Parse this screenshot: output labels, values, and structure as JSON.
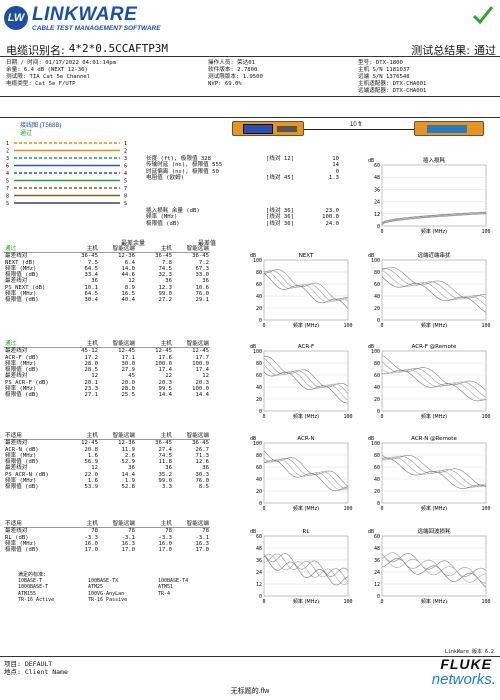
{
  "brand": {
    "logo_letters": "LW",
    "name": "LINKWARE",
    "tagline": "CABLE TEST MANAGEMENT SOFTWARE",
    "accent": "#1b4fa3",
    "pass_color": "#2aa52a"
  },
  "header": {
    "cable_id_label": "电缆识别名:",
    "cable_id": "4*2*0.5CCAFTP3M",
    "overall_label": "测试总结果:",
    "overall": "通过",
    "left_lines": [
      "日期 / 时间: 01/17/2022 04:01:14pm",
      "余量: 6.4 dB (NEXT 12-36)",
      "测试限: TIA Cat 5e Channel",
      "电缆类型: Cat 5e F/UTP"
    ],
    "mid_lines": [
      "操作人员: 荣达01",
      "软件版本: 2.7800",
      "测试限版本: 1.9500",
      "NVP: 69.0%"
    ],
    "right_lines": [
      "型号: DTX-1800",
      "主机 S/N 1181037",
      "远端 S/N 1376548",
      "主机适配器: DTX-CHA001",
      "远端适配器: DTX-CHA001"
    ]
  },
  "wiremap": {
    "title": "接线图 (T568B)",
    "result": "通过",
    "pins_left": [
      "1",
      "2",
      "3",
      "6",
      "4",
      "5",
      "7",
      "8",
      "S"
    ],
    "pins_right": [
      "1",
      "2",
      "3",
      "6",
      "4",
      "5",
      "7",
      "8",
      "S"
    ],
    "length_label": "10 ft",
    "colors": [
      "#e88a1a",
      "#e88a1a",
      "#2e9a3a",
      "#2b55c6",
      "#2b55c6",
      "#2e9a3a",
      "#8a5a2a",
      "#8a5a2a",
      "#444444"
    ]
  },
  "summary": {
    "rows": [
      {
        "label": "长度 (ft), 极限值 328",
        "pair": "[线对 12]",
        "value": "10"
      },
      {
        "label": "传输时延 (ns), 极限值 555",
        "pair": "",
        "value": "14"
      },
      {
        "label": "时延偏离 (ns), 极限值 50",
        "pair": "",
        "value": "0"
      },
      {
        "label": "电阻值 (欧姆)",
        "pair": "[线对 45]",
        "value": "1.3"
      }
    ],
    "il_rows": [
      {
        "label": "插入损耗 余量 (dB)",
        "pair": "[线对 36]",
        "value": "23.0"
      },
      {
        "label": "频率 (MHz)",
        "pair": "[线对 36]",
        "value": "100.0"
      },
      {
        "label": "极限值 (dB)",
        "pair": "[线对 36]",
        "value": "24.0"
      }
    ]
  },
  "charts": {
    "il": {
      "title": "插入损耗",
      "unit": "dB",
      "yticks": [
        "60",
        "48",
        "36",
        "24",
        "12",
        "0"
      ],
      "xticks": [
        "0",
        "100"
      ],
      "xlabel": "频率 (MHz)"
    },
    "next": {
      "title": "NEXT",
      "unit": "dB",
      "yticks": [
        "100",
        "80",
        "60",
        "40",
        "20",
        "0"
      ],
      "xticks": [
        "0",
        "100"
      ],
      "xlabel": "频率 (MHz)"
    },
    "next_r": {
      "title": "远端近端串扰",
      "unit": "dB",
      "yticks": [
        "100",
        "80",
        "60",
        "40",
        "20",
        "0"
      ],
      "xticks": [
        "0",
        "100"
      ],
      "xlabel": "频率 (MHz)"
    },
    "acrf": {
      "title": "ACR-F",
      "unit": "dB",
      "yticks": [
        "100",
        "80",
        "60",
        "40",
        "20",
        "0"
      ],
      "xticks": [
        "0",
        "100"
      ],
      "xlabel": "频率 (MHz)"
    },
    "acrf_r": {
      "title": "ACR-F @Remote",
      "unit": "dB",
      "yticks": [
        "100",
        "80",
        "60",
        "40",
        "20",
        "0"
      ],
      "xticks": [
        "0",
        "100"
      ],
      "xlabel": "频率 (MHz)"
    },
    "acrn": {
      "title": "ACR-N",
      "unit": "dB",
      "yticks": [
        "100",
        "80",
        "60",
        "40",
        "20",
        "0"
      ],
      "xticks": [
        "0",
        "100"
      ],
      "xlabel": "频率 (MHz)"
    },
    "acrn_r": {
      "title": "ACR-N @Remote",
      "unit": "dB",
      "yticks": [
        "100",
        "80",
        "60",
        "40",
        "20",
        "0"
      ],
      "xticks": [
        "0",
        "100"
      ],
      "xlabel": "频率 (MHz)"
    },
    "rl": {
      "title": "RL",
      "unit": "dB",
      "yticks": [
        "60",
        "48",
        "36",
        "24",
        "12",
        "0"
      ],
      "xticks": [
        "0",
        "100"
      ],
      "xlabel": "频率 (MHz)"
    },
    "rl_r": {
      "title": "远端回波损耗",
      "unit": "dB",
      "yticks": [
        "60",
        "48",
        "36",
        "24",
        "12",
        "0"
      ],
      "xticks": [
        "0",
        "100"
      ],
      "xlabel": "频率 (MHz)"
    }
  },
  "tables": [
    {
      "top": [
        "最差余量",
        "最差值"
      ],
      "rows": [
        [
          "通过",
          "主机",
          "智能远端",
          "主机",
          "智能远端"
        ],
        [
          "最差线对",
          "36-45",
          "12-36",
          "36-45",
          "36-45"
        ],
        [
          "NEXT (dB)",
          "7.5",
          "6.4",
          "7.8",
          "7.2"
        ],
        [
          "频率 (MHz)",
          "64.5",
          "14.0",
          "74.5",
          "67.3"
        ],
        [
          "极限值 (dB)",
          "33.4",
          "44.6",
          "32.3",
          "33.0"
        ],
        [
          "最差线对",
          "36",
          "12",
          "36",
          "36"
        ],
        [
          "PS NEXT (dB)",
          "10.1",
          "8.9",
          "12.3",
          "10.6"
        ],
        [
          "频率 (MHz)",
          "64.5",
          "16.5",
          "99.0",
          "76.0"
        ],
        [
          "极限值 (dB)",
          "30.4",
          "40.4",
          "27.2",
          "29.1"
        ]
      ]
    },
    {
      "top": [],
      "rows": [
        [
          "通过",
          "主机",
          "智能远端",
          "主机",
          "智能远端"
        ],
        [
          "最差线对",
          "45-12",
          "12-45",
          "12-45",
          "12-45"
        ],
        [
          "ACR-F (dB)",
          "17.2",
          "17.1",
          "17.6",
          "17.7"
        ],
        [
          "频率 (MHz)",
          "28.0",
          "30.0",
          "100.0",
          "100.0"
        ],
        [
          "极限值 (dB)",
          "28.5",
          "27.9",
          "17.4",
          "17.4"
        ],
        [
          "最差线对",
          "12",
          "45",
          "12",
          "12"
        ],
        [
          "PS ACR-F (dB)",
          "20.1",
          "20.0",
          "20.3",
          "20.3"
        ],
        [
          "频率 (MHz)",
          "23.3",
          "28.0",
          "99.5",
          "100.0"
        ],
        [
          "极限值 (dB)",
          "27.1",
          "25.5",
          "14.4",
          "14.4"
        ]
      ]
    },
    {
      "top": [],
      "rows": [
        [
          "不适用",
          "主机",
          "智能远端",
          "主机",
          "智能远端"
        ],
        [
          "最差线对",
          "12-45",
          "12-36",
          "36-45",
          "36-45"
        ],
        [
          "ACR-N (dB)",
          "20.8",
          "11.9",
          "27.4",
          "26.7"
        ],
        [
          "频率 (MHz)",
          "1.6",
          "2.6",
          "74.5",
          "71.3"
        ],
        [
          "极限值 (dB)",
          "56.9",
          "52.9",
          "11.8",
          "12.6"
        ],
        [
          "最差线对",
          "12",
          "36",
          "36",
          "36"
        ],
        [
          "PS ACR-N (dB)",
          "22.0",
          "14.4",
          "35.2",
          "30.3"
        ],
        [
          "频率 (MHz)",
          "1.6",
          "1.9",
          "99.0",
          "76.0"
        ],
        [
          "极限值 (dB)",
          "53.9",
          "52.8",
          "3.3",
          "8.5"
        ]
      ]
    },
    {
      "top": [],
      "rows": [
        [
          "不适用",
          "主机",
          "智能远端",
          "主机",
          "智能远端"
        ],
        [
          "最差线对",
          "78",
          "78",
          "78",
          "78"
        ],
        [
          "RL (dB)",
          "-3.3",
          "-3.1",
          "-3.3",
          "-3.1"
        ],
        [
          "频率 (MHz)",
          "16.0",
          "16.3",
          "16.0",
          "16.3"
        ],
        [
          "极限值 (dB)",
          "17.0",
          "17.0",
          "17.0",
          "17.0"
        ]
      ]
    }
  ],
  "compliant": {
    "title": "满足的标准:",
    "cols": [
      [
        "10BASE-T",
        "1000BASE-T",
        "ATM155",
        "TR-16 Active"
      ],
      [
        "100BASE-TX",
        "ATM25",
        "100VG-AnyLan",
        "TR-16 Passive"
      ],
      [
        "100BASE-T4",
        "ATM51",
        "TR-4",
        ""
      ]
    ]
  },
  "footer": {
    "project": "项目: DEFAULT",
    "site": "地点: Client Name",
    "version": "LinkWare 版本 6.2",
    "fluke": "FLUKE",
    "networks": "networks.",
    "file": "无标题的.flw"
  }
}
